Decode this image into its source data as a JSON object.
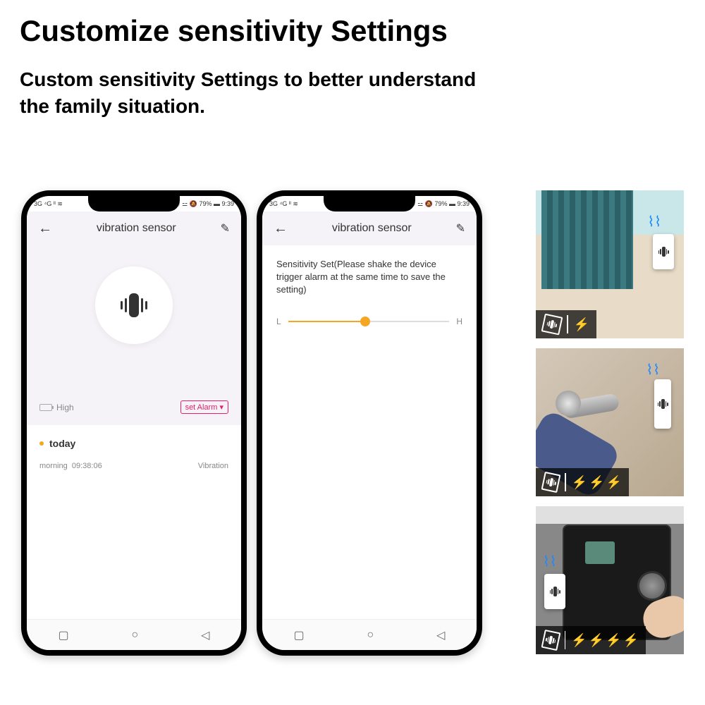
{
  "header": {
    "title": "Customize sensitivity Settings",
    "subtitle_line1": "Custom sensitivity Settings to better understand",
    "subtitle_line2": "the family situation."
  },
  "status_bar": {
    "left": "3G ⁴G ᴵᴵ ≋",
    "right": "ℕ ⚪ ⚍ 🔕 79% ▬ 9:39"
  },
  "phone1": {
    "title": "vibration sensor",
    "battery_label": "High",
    "set_alarm": "set Alarm ▾",
    "today_label": "today",
    "event_time_label": "morning",
    "event_time": "09:38:06",
    "event_type": "Vibration"
  },
  "phone2": {
    "title": "vibration sensor",
    "sensitivity_text": "Sensitivity Set(Please shake the device trigger alarm at the same time to save the setting)",
    "slider_low": "L",
    "slider_high": "H"
  },
  "nav": {
    "square": "▢",
    "circle": "○",
    "triangle": "◁"
  },
  "tiles": {
    "bolt": "⚡",
    "tile1_bolts": 1,
    "tile2_bolts": 3,
    "tile3_bolts": 4
  }
}
